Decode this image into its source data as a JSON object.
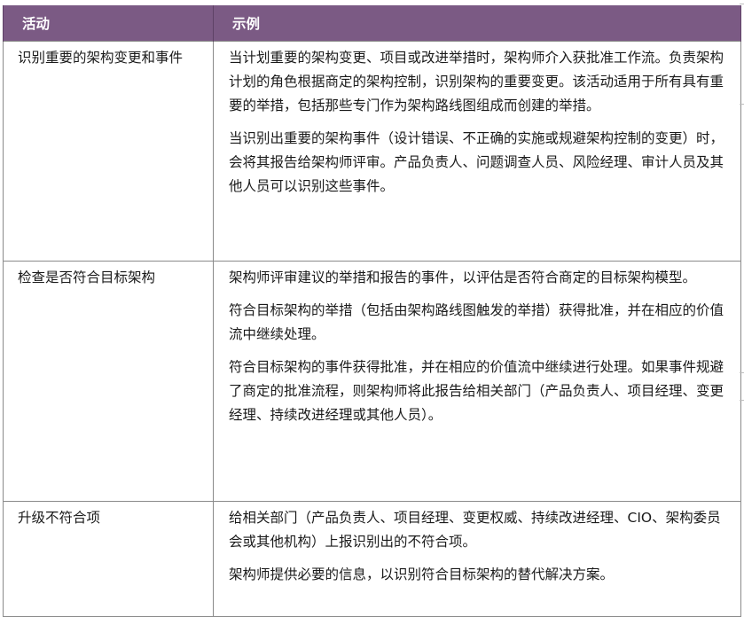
{
  "table": {
    "header": {
      "activity": "活动",
      "examples": "示例"
    },
    "rows": [
      {
        "activity": "识别重要的架构变更和事件",
        "examples": [
          "当计划重要的架构变更、项目或改进举措时，架构师介入获批准工作流。负责架构计划的角色根据商定的架构控制，识别架构的重要变更。该活动适用于所有具有重要的举措，包括那些专门作为架构路线图组成而创建的举措。",
          "当识别出重要的架构事件（设计错误、不正确的实施或规避架构控制的变更）时，会将其报告给架构师评审。产品负责人、问题调查人员、风险经理、审计人员及其他人员可以识别这些事件。"
        ]
      },
      {
        "activity": "检查是否符合目标架构",
        "examples": [
          "架构师评审建议的举措和报告的事件，以评估是否符合商定的目标架构模型。",
          "符合目标架构的举措（包括由架构路线图触发的举措）获得批准，并在相应的价值流中继续处理。",
          "符合目标架构的事件获得批准，并在相应的价值流中继续进行处理。如果事件规避了商定的批准流程，则架构师将此报告给相关部门（产品负责人、项目经理、变更经理、持续改进经理或其他人员）。"
        ]
      },
      {
        "activity": "升级不符合项",
        "examples": [
          "给相关部门（产品负责人、项目经理、变更权威、持续改进经理、CIO、架构委员会或其他机构）上报识别出的不符合项。",
          "架构师提供必要的信息，以识别符合目标架构的替代解决方案。"
        ]
      }
    ]
  },
  "colors": {
    "header_background": "#7b5a84",
    "header_text": "#ffffff",
    "border": "#8a8a8a"
  }
}
